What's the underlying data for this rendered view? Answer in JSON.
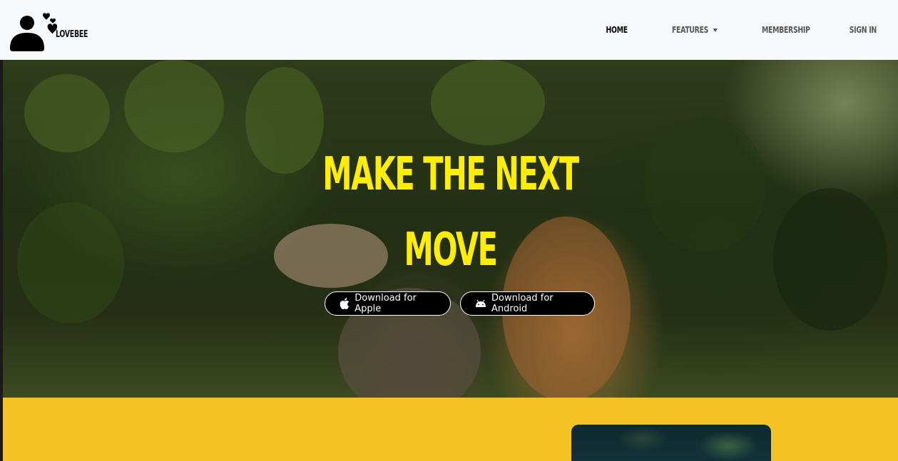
{
  "brand": {
    "name": "LOVEBEE",
    "logo_icon": "couple-hearts-icon"
  },
  "nav": {
    "items": [
      {
        "label": "HOME",
        "active": true
      },
      {
        "label": "FEATURES",
        "dropdown": true
      },
      {
        "label": "MEMBERSHIP"
      },
      {
        "label": "SIGN IN"
      }
    ]
  },
  "hero": {
    "title_line1": "MAKE THE NEXT",
    "title_line2": "MOVE",
    "title_color": "#ffee00",
    "buttons": {
      "apple": {
        "label": "Download for Apple",
        "icon": "apple-icon"
      },
      "android": {
        "label": "Download for Android",
        "icon": "android-icon"
      }
    }
  },
  "feature": {
    "background": "#f4c323"
  }
}
